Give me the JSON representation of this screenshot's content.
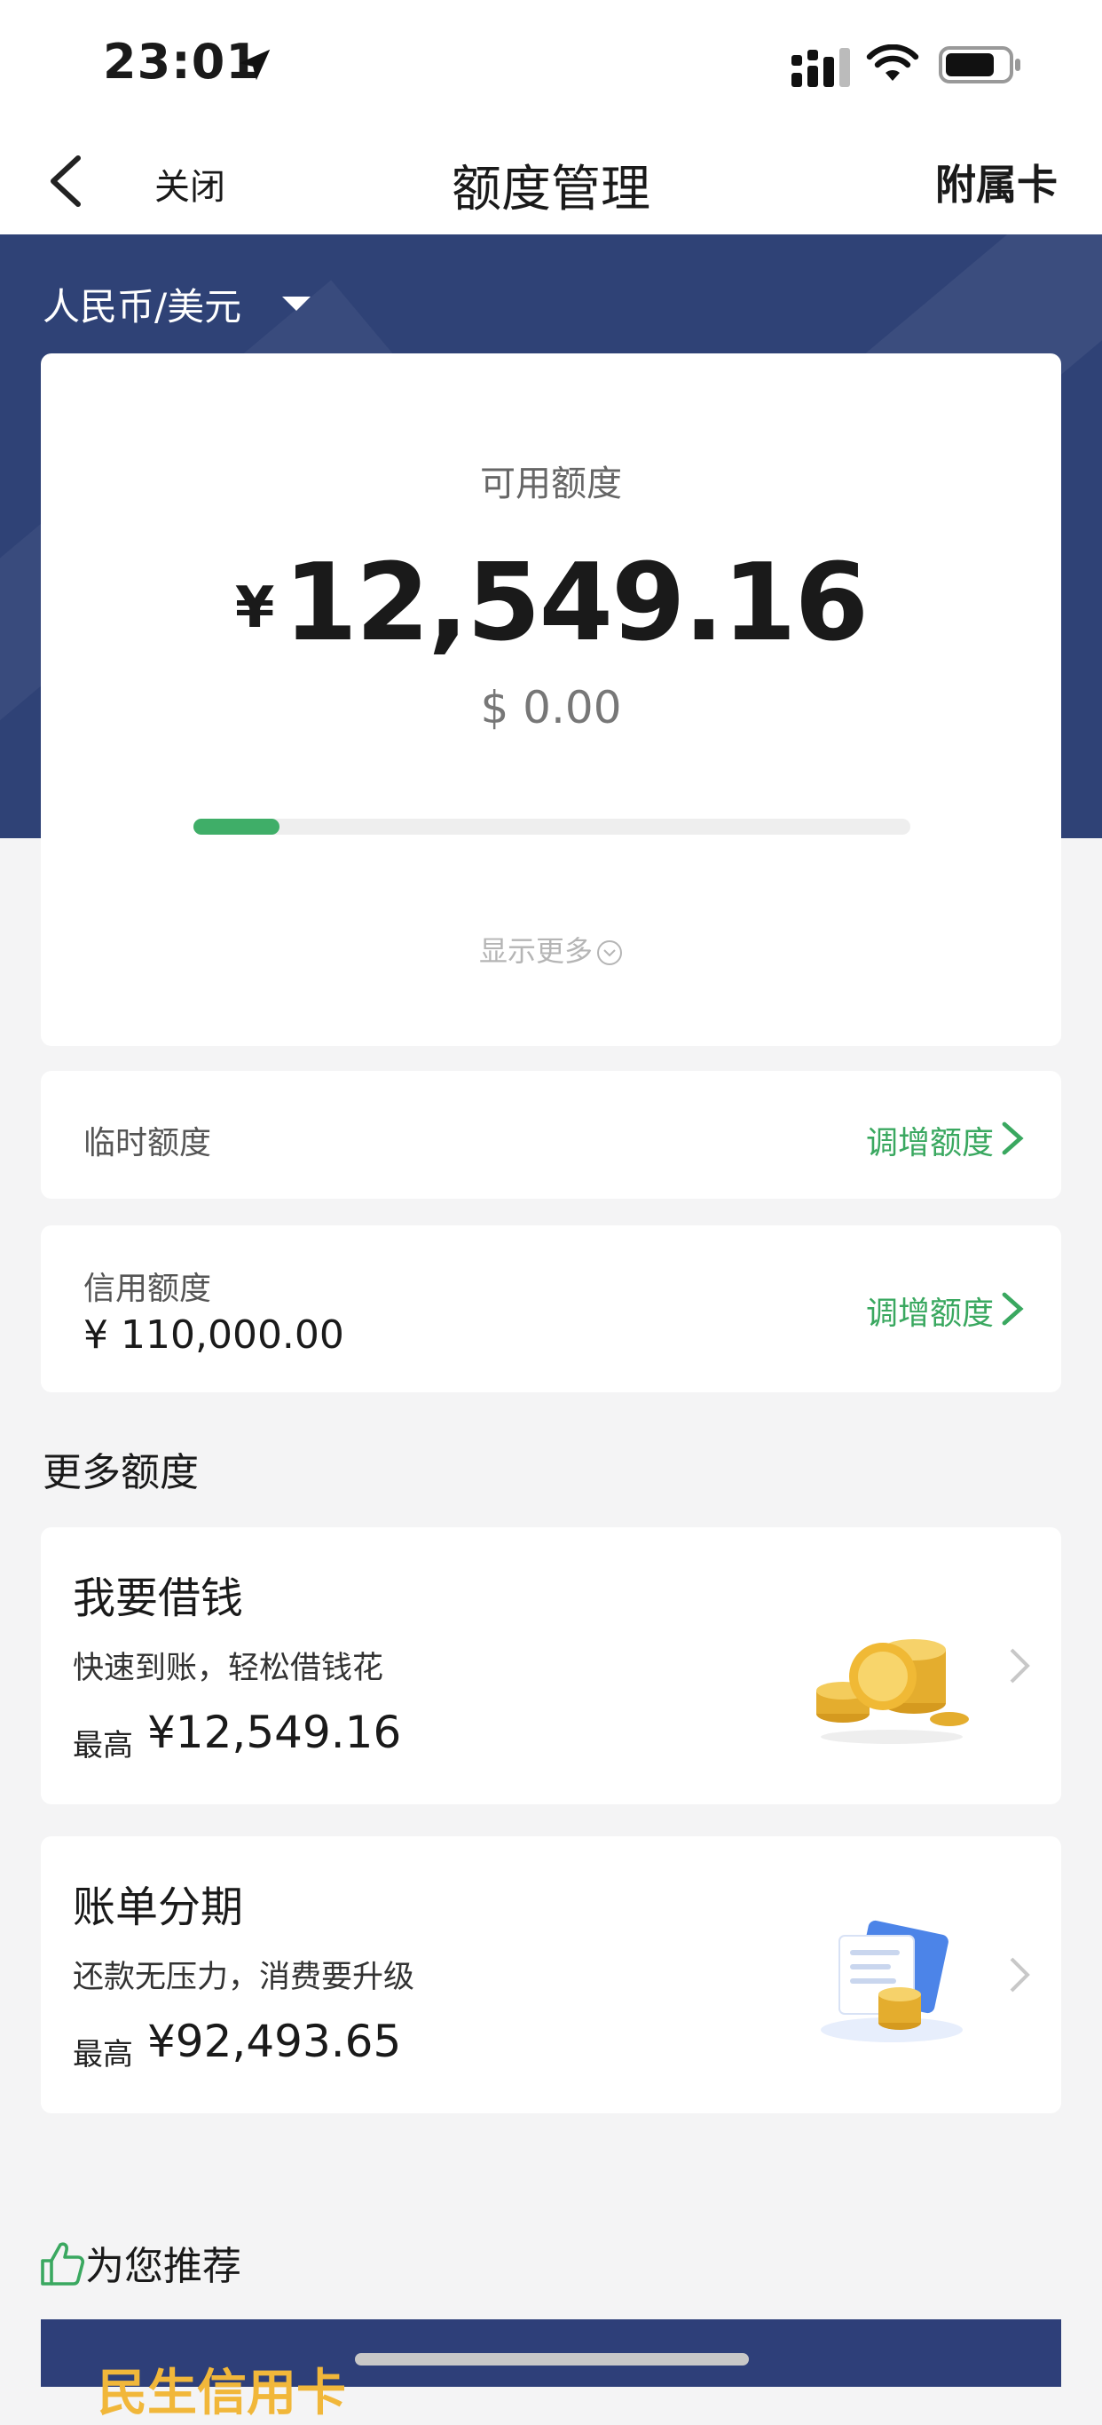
{
  "status_bar": {
    "time": "23:01"
  },
  "nav": {
    "close_label": "关闭",
    "title": "额度管理",
    "right_label": "附属卡"
  },
  "currency_selector": {
    "label": "人民币/美元"
  },
  "available": {
    "label": "可用额度",
    "currency_symbol": "¥",
    "amount": "12,549.16",
    "usd_amount": "$ 0.00",
    "usage_fraction": 0.12,
    "show_more_label": "显示更多"
  },
  "temporary_limit": {
    "label": "临时额度",
    "action_label": "调增额度"
  },
  "credit_limit": {
    "label": "信用额度",
    "value": "¥ 110,000.00",
    "action_label": "调增额度"
  },
  "more_section": {
    "title": "更多额度"
  },
  "borrow": {
    "title": "我要借钱",
    "subtitle": "快速到账，轻松借钱花",
    "max_label": "最高",
    "max_value": "¥12,549.16",
    "icon": "gold-coins-icon"
  },
  "installment": {
    "title": "账单分期",
    "subtitle": "还款无压力，消费要升级",
    "max_label": "最高",
    "max_value": "¥92,493.65",
    "icon": "bill-coins-icon"
  },
  "recommend": {
    "title": "为您推荐",
    "banner_text": "民生信用卡"
  },
  "colors": {
    "brand_blue": "#2f4276",
    "accent_green": "#3fae68",
    "link_green": "#3aa860",
    "banner_gold": "#f1b73a"
  }
}
